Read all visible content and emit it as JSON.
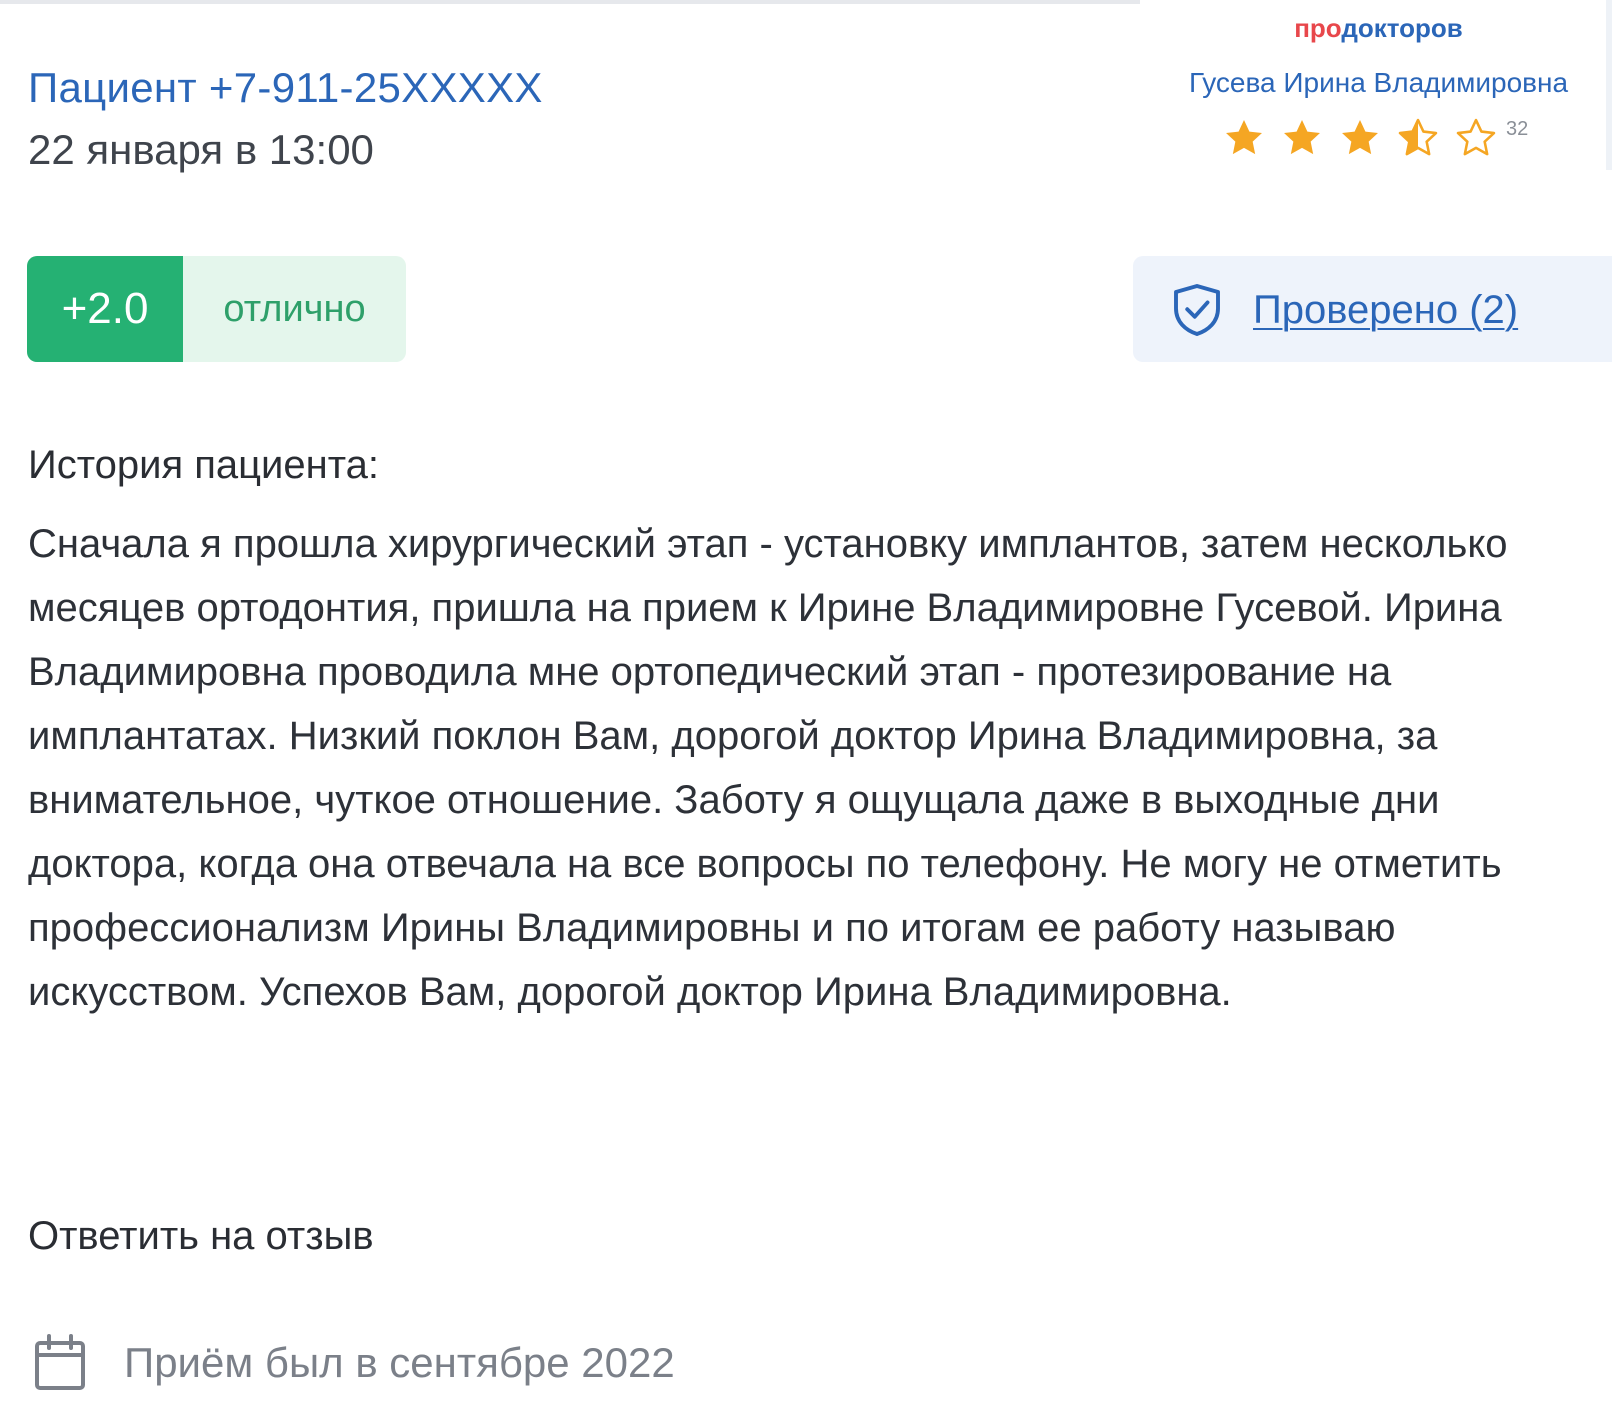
{
  "review": {
    "patient_name": "Пациент +7-911-25XXXXX",
    "date": "22 января в 13:00",
    "score_value": "+2.0",
    "score_label": "отлично",
    "verified_label": "Проверено (2)",
    "history_title": "История пациента:",
    "history_text": "Сначала я прошла хирургический этап - установку имплантов, затем несколько месяцев ортодонтия, пришла на прием к Ирине Владимировне Гусевой. Ирина Владимировна проводила мне ортопедический этап - протезирование на имплантатах. Низкий поклон Вам, дорогой доктор Ирина Владимировна, за внимательное, чуткое отношение. Заботу я ощущала даже в выходные дни доктора, когда она отвечала на все вопросы по телефону. Не могу не отметить профессионализм Ирины Владимировны и по итогам ее работу называю искусством. Успехов Вам, дорогой доктор Ирина Владимировна.",
    "reply_label": "Ответить на отзыв",
    "visit_text": "Приём был в сентябре 2022"
  },
  "widget": {
    "logo_pro": "про",
    "logo_doc": "докторов",
    "doctor_name": "Гусева Ирина Владимировна",
    "rating_stars": 3.5,
    "rating_max": 5,
    "reviews_count": "32"
  },
  "colors": {
    "link_blue": "#2b66b8",
    "score_green": "#25b173",
    "score_bg": "#e4f6ec",
    "star_orange": "#f5a623",
    "logo_red": "#e8474b",
    "verified_bg": "#eef3fb"
  },
  "icons": {
    "stars": "star-icon",
    "verified": "shield-check-icon",
    "visit": "calendar-icon"
  }
}
